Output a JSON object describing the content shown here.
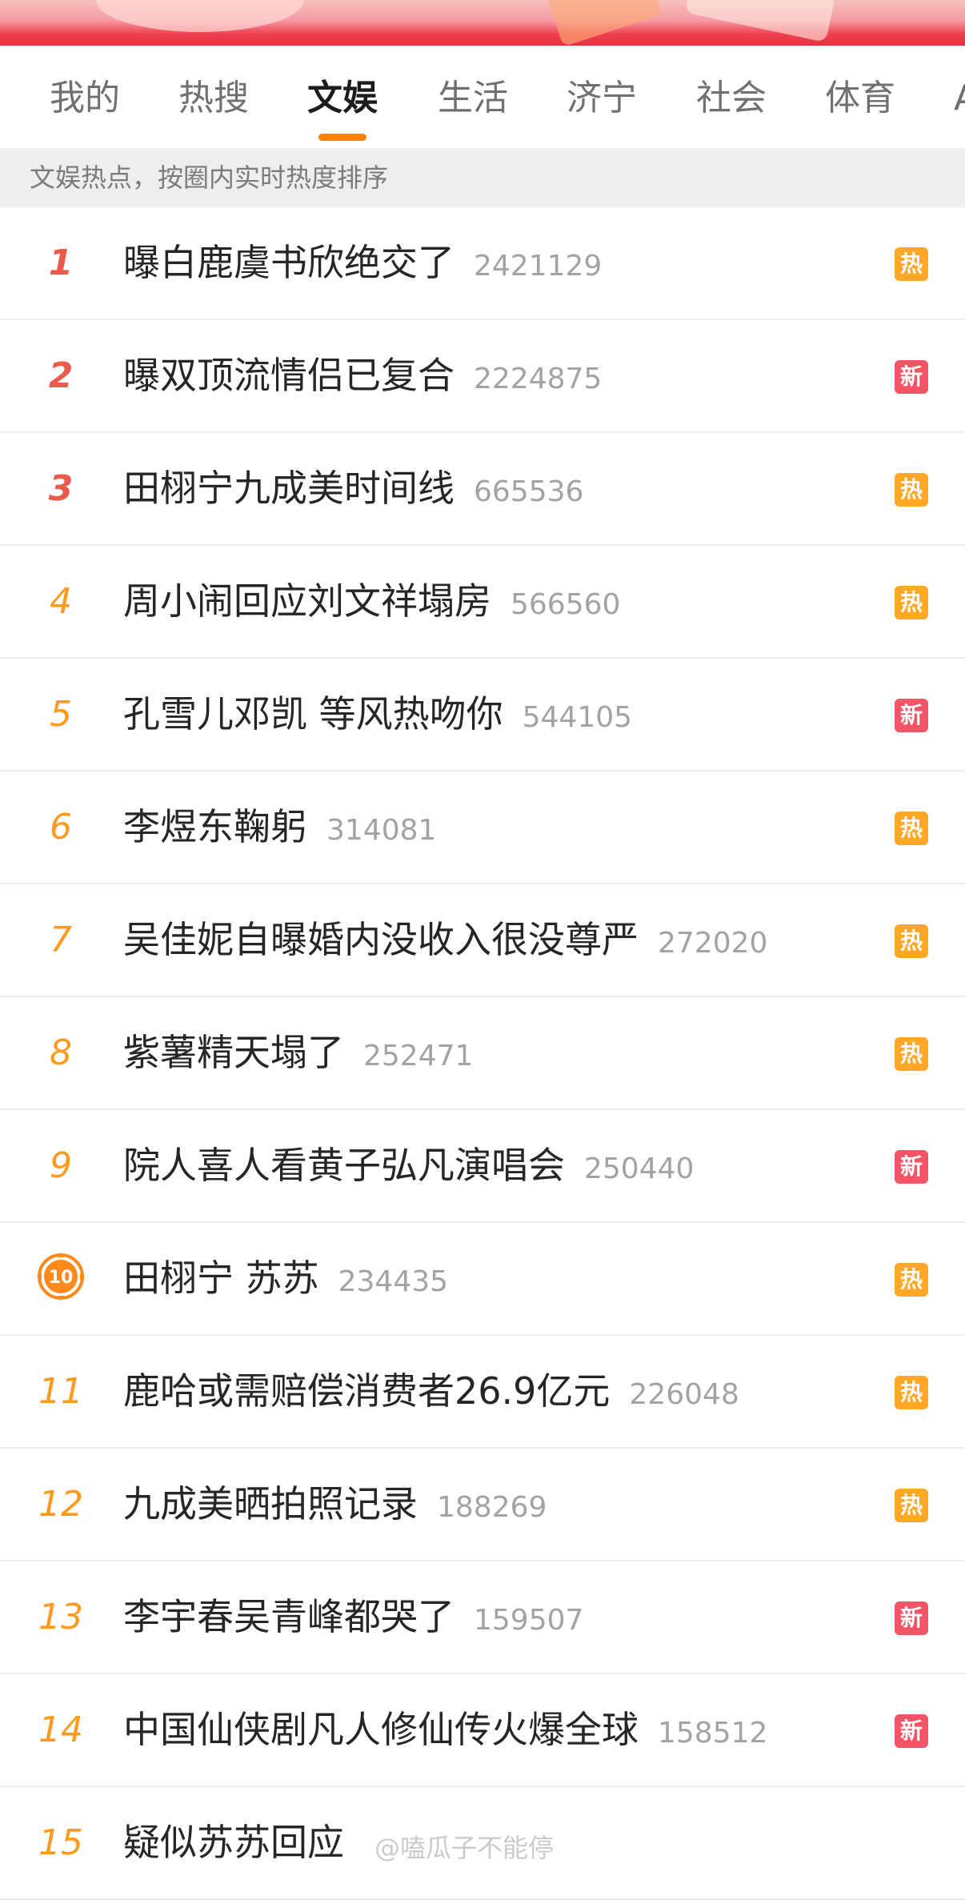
{
  "tabs": [
    {
      "label": "我的"
    },
    {
      "label": "热搜"
    },
    {
      "label": "文娱",
      "active": true
    },
    {
      "label": "生活"
    },
    {
      "label": "济宁"
    },
    {
      "label": "社会"
    },
    {
      "label": "体育"
    },
    {
      "label": "A"
    }
  ],
  "hint": "文娱热点，按圈内实时热度排序",
  "tag_colors": {
    "hot": "#ffa726",
    "new": "#f35466",
    "accent": "#ff8200"
  },
  "items": [
    {
      "rank": "1",
      "title": "曝白鹿虞书欣绝交了",
      "count": "2421129",
      "tag": "热",
      "tag_type": "hot"
    },
    {
      "rank": "2",
      "title": "曝双顶流情侣已复合",
      "count": "2224875",
      "tag": "新",
      "tag_type": "new"
    },
    {
      "rank": "3",
      "title": "田栩宁九成美时间线",
      "count": "665536",
      "tag": "热",
      "tag_type": "hot"
    },
    {
      "rank": "4",
      "title": "周小闹回应刘文祥塌房",
      "count": "566560",
      "tag": "热",
      "tag_type": "hot"
    },
    {
      "rank": "5",
      "title": "孔雪儿邓凯 等风热吻你",
      "count": "544105",
      "tag": "新",
      "tag_type": "new"
    },
    {
      "rank": "6",
      "title": "李煜东鞠躬",
      "count": "314081",
      "tag": "热",
      "tag_type": "hot"
    },
    {
      "rank": "7",
      "title": "吴佳妮自曝婚内没收入很没尊严",
      "count": "272020",
      "tag": "热",
      "tag_type": "hot"
    },
    {
      "rank": "8",
      "title": "紫薯精天塌了",
      "count": "252471",
      "tag": "热",
      "tag_type": "hot"
    },
    {
      "rank": "9",
      "title": "院人喜人看黄子弘凡演唱会",
      "count": "250440",
      "tag": "新",
      "tag_type": "new"
    },
    {
      "rank": "10",
      "title": "田栩宁 苏苏",
      "count": "234435",
      "tag": "热",
      "tag_type": "hot",
      "medal": true
    },
    {
      "rank": "11",
      "title": "鹿哈或需赔偿消费者26.9亿元",
      "count": "226048",
      "tag": "热",
      "tag_type": "hot"
    },
    {
      "rank": "12",
      "title": "九成美晒拍照记录",
      "count": "188269",
      "tag": "热",
      "tag_type": "hot"
    },
    {
      "rank": "13",
      "title": "李宇春吴青峰都哭了",
      "count": "159507",
      "tag": "新",
      "tag_type": "new"
    },
    {
      "rank": "14",
      "title": "中国仙侠剧凡人修仙传火爆全球",
      "count": "158512",
      "tag": "新",
      "tag_type": "new"
    },
    {
      "rank": "15",
      "title": "疑似苏苏回应",
      "count": "",
      "tag": "",
      "tag_type": ""
    }
  ],
  "watermark": "@嗑瓜子不能停"
}
